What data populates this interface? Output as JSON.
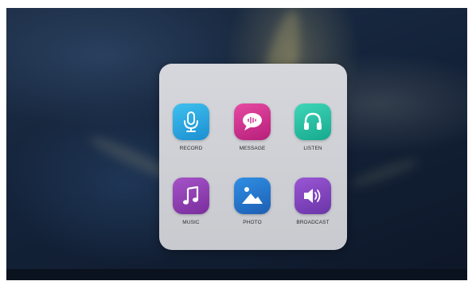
{
  "apps": [
    {
      "label": "RECORD",
      "icon": "microphone-icon",
      "color": "#2aa6e2"
    },
    {
      "label": "MESSAGE",
      "icon": "chat-bubble-icon",
      "color": "#d2368f"
    },
    {
      "label": "LISTEN",
      "icon": "headphones-icon",
      "color": "#27c1a3"
    },
    {
      "label": "MUSIC",
      "icon": "music-note-icon",
      "color": "#8f41b2"
    },
    {
      "label": "PHOTO",
      "icon": "image-icon",
      "color": "#2677cc"
    },
    {
      "label": "BROADCAST",
      "icon": "speaker-icon",
      "color": "#8246bf"
    }
  ]
}
